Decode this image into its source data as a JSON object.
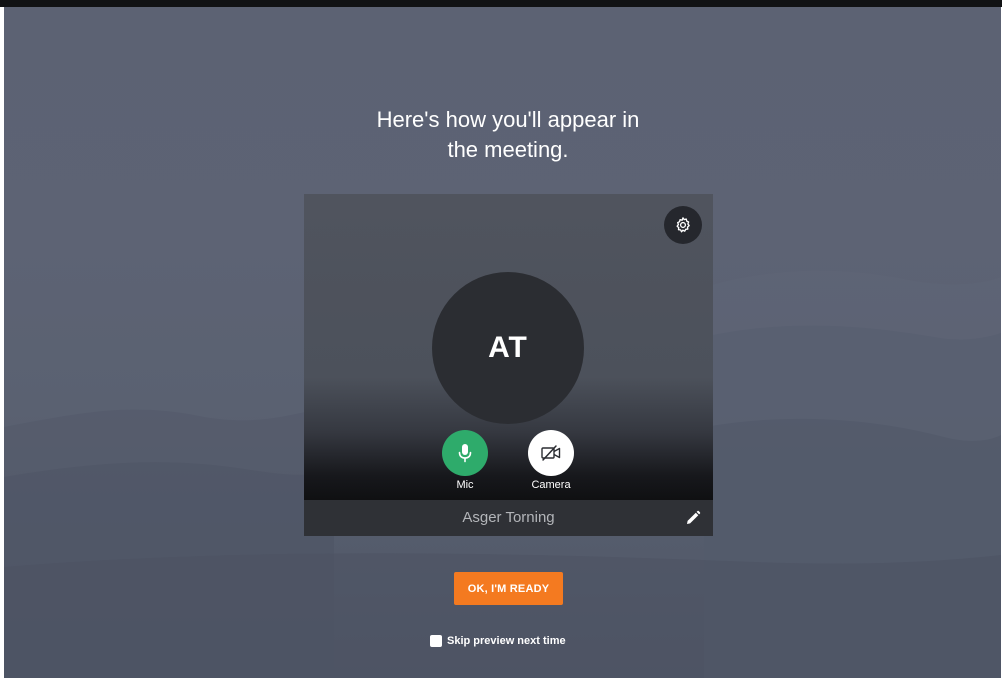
{
  "page": {
    "headline_line1": "Here's how you'll appear in",
    "headline_line2": "the meeting."
  },
  "preview": {
    "settings_icon": "gear-icon",
    "avatar_initials": "AT",
    "controls": [
      {
        "label": "Mic",
        "icon": "microphone-icon",
        "state": "on",
        "color": "#2eab6b"
      },
      {
        "label": "Camera",
        "icon": "camera-off-icon",
        "state": "off",
        "color": "#ffffff"
      }
    ],
    "display_name": "Asger Torning",
    "edit_icon": "pencil-icon"
  },
  "actions": {
    "ready_label": "OK, I'M READY",
    "ready_color": "#f47a20",
    "skip_label": "Skip preview next time",
    "skip_checked": false
  }
}
